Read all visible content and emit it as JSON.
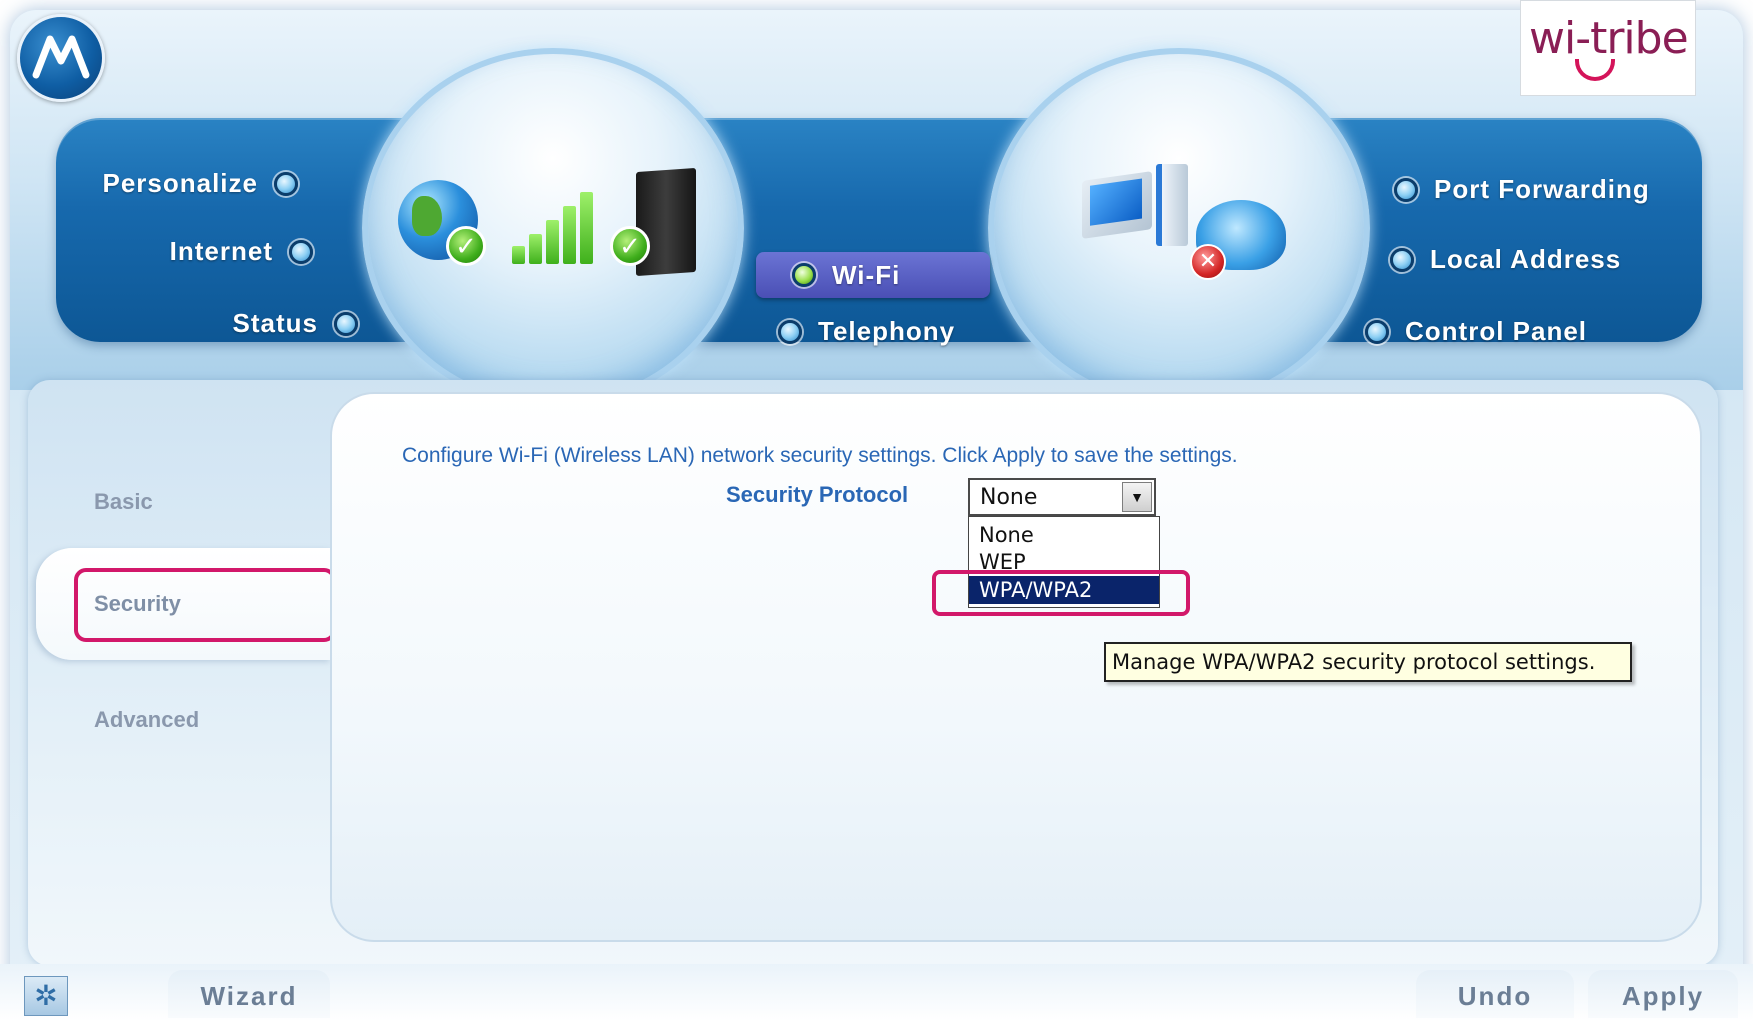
{
  "header": {
    "brand_logo_text": "wi-tribe"
  },
  "nav": {
    "left_items": [
      {
        "label": "Personalize"
      },
      {
        "label": "Internet"
      },
      {
        "label": "Status"
      }
    ],
    "center_items": [
      {
        "label": "Wi-Fi",
        "active": true
      },
      {
        "label": "Telephony"
      }
    ],
    "right_items": [
      {
        "label": "Port Forwarding"
      },
      {
        "label": "Local Address"
      },
      {
        "label": "Control Panel"
      }
    ]
  },
  "sidebar": {
    "items": [
      {
        "label": "Basic"
      },
      {
        "label": "Security",
        "active": true
      },
      {
        "label": "Advanced"
      }
    ]
  },
  "main": {
    "description": "Configure Wi-Fi (Wireless LAN) network security settings. Click Apply to save the settings.",
    "security_protocol_label": "Security Protocol",
    "security_protocol_value": "None",
    "options": [
      "None",
      "WEP",
      "WPA/WPA2"
    ],
    "highlighted_option": "WPA/WPA2",
    "tooltip": "Manage WPA/WPA2 security protocol settings."
  },
  "footer": {
    "wizard_label": "Wizard",
    "undo_label": "Undo",
    "apply_label": "Apply"
  },
  "colors": {
    "nav_blue": "#1769ad",
    "link_blue": "#2a67b5",
    "highlight_magenta": "#d2186a",
    "selection_navy": "#0a246a"
  },
  "icons": [
    "motorola-logo-icon",
    "globe-icon",
    "signal-bars-icon",
    "modem-icon",
    "computer-icon",
    "phone-icon",
    "check-icon",
    "error-x-icon",
    "chevron-down-icon",
    "gear-icon"
  ]
}
